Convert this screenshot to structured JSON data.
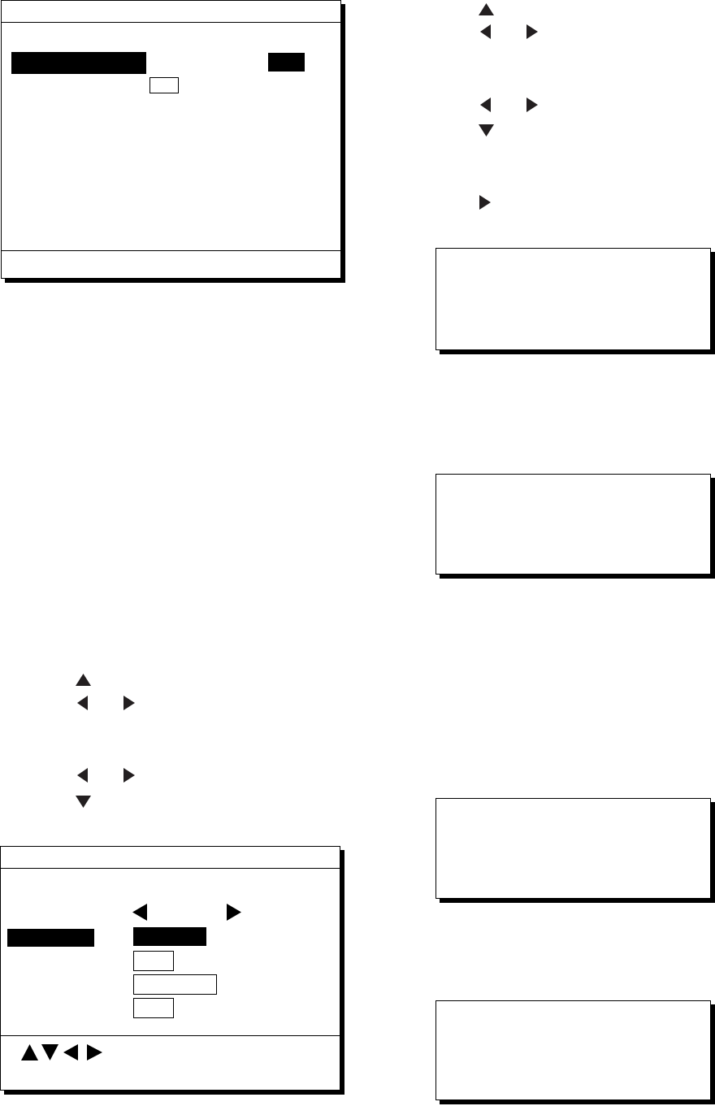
{
  "settings_menu": {
    "items": [
      {
        "selected": true
      }
    ],
    "values": [
      {
        "selected": true
      },
      {
        "selected": false
      }
    ]
  },
  "option_menu": {
    "items": [
      {
        "selected": true
      }
    ],
    "options": [
      {
        "selected": true
      },
      {
        "selected": false
      },
      {
        "selected": false
      },
      {
        "selected": false
      }
    ]
  }
}
